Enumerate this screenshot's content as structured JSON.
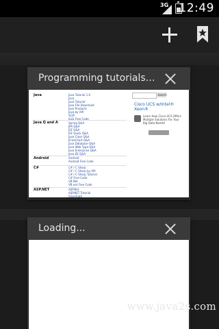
{
  "status_bar": {
    "network": "3G",
    "time": "12:49"
  },
  "action_bar": {
    "icons": [
      "add-icon",
      "bookmark-icon"
    ]
  },
  "tabs": [
    {
      "title": "Programming tutorials an...",
      "preview": {
        "ad": {
          "search_button": "Search",
          "title": "Cisco UCS w/Intel® Xeon®",
          "text": "Learn How Cisco UCS Offers Multiple Solutions For Your Big Data Needs!"
        }
      }
    },
    {
      "title": "Loading..."
    }
  ],
  "watermark": "www.java2s.com",
  "colors": {
    "background": "#1c1c1c",
    "status_bar": "#000000",
    "action_bar": "#202020",
    "tab_header": "#3a3a3a",
    "preview": "#ffffff"
  }
}
